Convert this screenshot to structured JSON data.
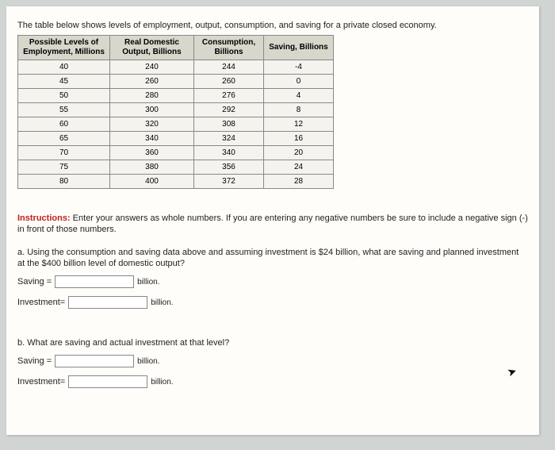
{
  "intro": "The table below shows levels of employment, output, consumption, and saving for a private closed economy.",
  "table": {
    "headers": [
      "Possible Levels of Employment, Millions",
      "Real Domestic Output, Billions",
      "Consumption, Billions",
      "Saving, Billions"
    ],
    "rows": [
      [
        "40",
        "240",
        "244",
        "-4"
      ],
      [
        "45",
        "260",
        "260",
        "0"
      ],
      [
        "50",
        "280",
        "276",
        "4"
      ],
      [
        "55",
        "300",
        "292",
        "8"
      ],
      [
        "60",
        "320",
        "308",
        "12"
      ],
      [
        "65",
        "340",
        "324",
        "16"
      ],
      [
        "70",
        "360",
        "340",
        "20"
      ],
      [
        "75",
        "380",
        "356",
        "24"
      ],
      [
        "80",
        "400",
        "372",
        "28"
      ]
    ]
  },
  "instructions_label": "Instructions:",
  "instructions_text": " Enter your answers as whole numbers. If you are entering any negative numbers be sure to include a negative sign (-) in front of those numbers.",
  "question_a": "a. Using the consumption and saving data above and assuming investment is $24 billion, what are saving and planned investment at the $400 billion level of domestic output?",
  "question_b": "b. What are saving and actual investment at that level?",
  "labels": {
    "saving": "Saving =",
    "investment": "Investment=",
    "unit": "billion."
  },
  "chart_data": {
    "type": "table",
    "title": "Employment, Output, Consumption, Saving (Private Closed Economy)",
    "columns": [
      "Possible Levels of Employment, Millions",
      "Real Domestic Output, Billions",
      "Consumption, Billions",
      "Saving, Billions"
    ],
    "rows": [
      {
        "employment": 40,
        "output": 240,
        "consumption": 244,
        "saving": -4
      },
      {
        "employment": 45,
        "output": 260,
        "consumption": 260,
        "saving": 0
      },
      {
        "employment": 50,
        "output": 280,
        "consumption": 276,
        "saving": 4
      },
      {
        "employment": 55,
        "output": 300,
        "consumption": 292,
        "saving": 8
      },
      {
        "employment": 60,
        "output": 320,
        "consumption": 308,
        "saving": 12
      },
      {
        "employment": 65,
        "output": 340,
        "consumption": 324,
        "saving": 16
      },
      {
        "employment": 70,
        "output": 360,
        "consumption": 340,
        "saving": 20
      },
      {
        "employment": 75,
        "output": 380,
        "consumption": 356,
        "saving": 24
      },
      {
        "employment": 80,
        "output": 400,
        "consumption": 372,
        "saving": 28
      }
    ]
  }
}
